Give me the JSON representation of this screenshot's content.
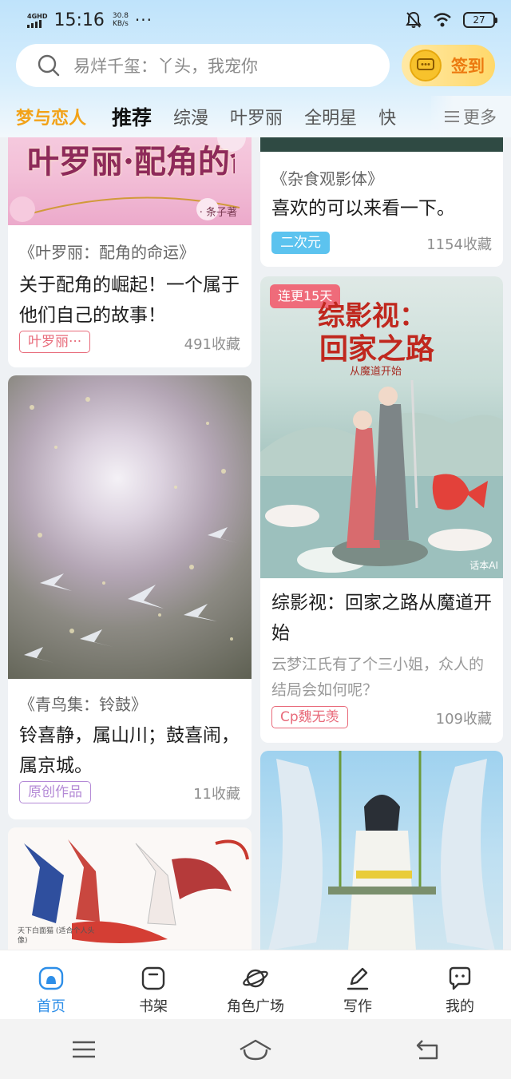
{
  "status_bar": {
    "network": "4GHD",
    "time": "15:16",
    "speed_value": "30.8",
    "speed_unit": "KB/s",
    "dots": "···",
    "battery": "27"
  },
  "search": {
    "placeholder": "易烊千玺：丫头，我宠你"
  },
  "checkin": {
    "label": "签到"
  },
  "tabs": [
    {
      "label": "梦与恋人"
    },
    {
      "label": "推荐"
    },
    {
      "label": "综漫"
    },
    {
      "label": "叶罗丽"
    },
    {
      "label": "全明星"
    },
    {
      "label": "快"
    }
  ],
  "more_label": "更多",
  "cards": [
    {
      "tagline": "《叶罗丽：配角的命运》",
      "title": "关于配角的崛起！一个属于他们自己的故事！",
      "tag": "叶罗丽···",
      "fav": "491收藏",
      "cover_text": "叶罗丽·配角的命运",
      "cover_sub": "· 条子著"
    },
    {
      "tagline": "《杂食观影体》",
      "title": "喜欢的可以来看一下。",
      "tag": "二次元",
      "fav": "1154收藏"
    },
    {
      "badge": "连更15天",
      "cover_text_1": "综影视：",
      "cover_text_2": "回家之路",
      "cover_sub": "从魔道开始",
      "watermark": "话本AI",
      "title": "综影视：回家之路从魔道开始",
      "desc": "云梦江氏有了个三小姐，众人的结局会如何呢？",
      "tag": "Cp魏无羡",
      "fav": "109收藏"
    },
    {
      "tagline": "《青鸟集：铃鼓》",
      "title": "铃喜静，属山川；鼓喜闹，属京城。",
      "tag": "原创作品",
      "fav": "11收藏"
    },
    {
      "cover_caption": "天下白面猫 (适合个人头像)"
    },
    {}
  ],
  "bottom_nav": [
    {
      "label": "首页",
      "icon": "home-icon"
    },
    {
      "label": "书架",
      "icon": "bookshelf-icon"
    },
    {
      "label": "角色广场",
      "icon": "planet-icon"
    },
    {
      "label": "写作",
      "icon": "pen-icon"
    },
    {
      "label": "我的",
      "icon": "chat-icon"
    }
  ],
  "colors": {
    "accent": "#2d8ee8",
    "brand": "#f2a218",
    "checkin": "#ec7a10",
    "tag_pink": "#e86a7a",
    "tag_blue": "#5cc3ef",
    "tag_purple": "#b48ad6"
  }
}
